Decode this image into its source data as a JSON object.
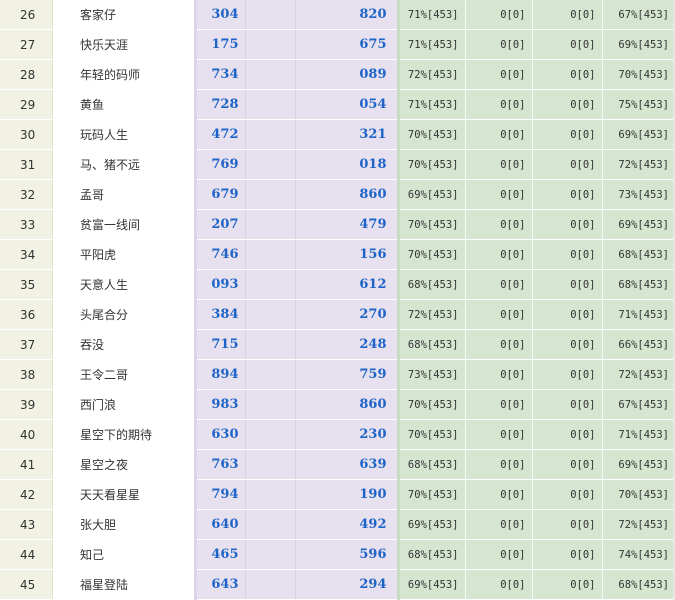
{
  "rows": [
    {
      "rank": "26",
      "name": "客家仔",
      "v1": "304",
      "v2": "820",
      "s1": "71%[453]",
      "s2": "0[0]",
      "s3": "0[0]",
      "s4": "67%[453]"
    },
    {
      "rank": "27",
      "name": "快乐天涯",
      "v1": "175",
      "v2": "675",
      "s1": "71%[453]",
      "s2": "0[0]",
      "s3": "0[0]",
      "s4": "69%[453]"
    },
    {
      "rank": "28",
      "name": "年轻的码师",
      "v1": "734",
      "v2": "089",
      "s1": "72%[453]",
      "s2": "0[0]",
      "s3": "0[0]",
      "s4": "70%[453]"
    },
    {
      "rank": "29",
      "name": "黄鱼",
      "v1": "728",
      "v2": "054",
      "s1": "71%[453]",
      "s2": "0[0]",
      "s3": "0[0]",
      "s4": "75%[453]"
    },
    {
      "rank": "30",
      "name": "玩码人生",
      "v1": "472",
      "v2": "321",
      "s1": "70%[453]",
      "s2": "0[0]",
      "s3": "0[0]",
      "s4": "69%[453]"
    },
    {
      "rank": "31",
      "name": "马、猪不远",
      "v1": "769",
      "v2": "018",
      "s1": "70%[453]",
      "s2": "0[0]",
      "s3": "0[0]",
      "s4": "72%[453]"
    },
    {
      "rank": "32",
      "name": "孟哥",
      "v1": "679",
      "v2": "860",
      "s1": "69%[453]",
      "s2": "0[0]",
      "s3": "0[0]",
      "s4": "73%[453]"
    },
    {
      "rank": "33",
      "name": "贫富一线间",
      "v1": "207",
      "v2": "479",
      "s1": "70%[453]",
      "s2": "0[0]",
      "s3": "0[0]",
      "s4": "69%[453]"
    },
    {
      "rank": "34",
      "name": "平阳虎",
      "v1": "746",
      "v2": "156",
      "s1": "70%[453]",
      "s2": "0[0]",
      "s3": "0[0]",
      "s4": "68%[453]"
    },
    {
      "rank": "35",
      "name": "天意人生",
      "v1": "093",
      "v2": "612",
      "s1": "68%[453]",
      "s2": "0[0]",
      "s3": "0[0]",
      "s4": "68%[453]"
    },
    {
      "rank": "36",
      "name": "头尾合分",
      "v1": "384",
      "v2": "270",
      "s1": "72%[453]",
      "s2": "0[0]",
      "s3": "0[0]",
      "s4": "71%[453]"
    },
    {
      "rank": "37",
      "name": "吞没",
      "v1": "715",
      "v2": "248",
      "s1": "68%[453]",
      "s2": "0[0]",
      "s3": "0[0]",
      "s4": "66%[453]"
    },
    {
      "rank": "38",
      "name": "王令二哥",
      "v1": "894",
      "v2": "759",
      "s1": "73%[453]",
      "s2": "0[0]",
      "s3": "0[0]",
      "s4": "72%[453]"
    },
    {
      "rank": "39",
      "name": "西门浪",
      "v1": "983",
      "v2": "860",
      "s1": "70%[453]",
      "s2": "0[0]",
      "s3": "0[0]",
      "s4": "67%[453]"
    },
    {
      "rank": "40",
      "name": "星空下的期待",
      "v1": "630",
      "v2": "230",
      "s1": "70%[453]",
      "s2": "0[0]",
      "s3": "0[0]",
      "s4": "71%[453]"
    },
    {
      "rank": "41",
      "name": "星空之夜",
      "v1": "763",
      "v2": "639",
      "s1": "68%[453]",
      "s2": "0[0]",
      "s3": "0[0]",
      "s4": "69%[453]"
    },
    {
      "rank": "42",
      "name": "天天看星星",
      "v1": "794",
      "v2": "190",
      "s1": "70%[453]",
      "s2": "0[0]",
      "s3": "0[0]",
      "s4": "70%[453]"
    },
    {
      "rank": "43",
      "name": "张大胆",
      "v1": "640",
      "v2": "492",
      "s1": "69%[453]",
      "s2": "0[0]",
      "s3": "0[0]",
      "s4": "72%[453]"
    },
    {
      "rank": "44",
      "name": "知己",
      "v1": "465",
      "v2": "596",
      "s1": "68%[453]",
      "s2": "0[0]",
      "s3": "0[0]",
      "s4": "74%[453]"
    },
    {
      "rank": "45",
      "name": "福星登陆",
      "v1": "643",
      "v2": "294",
      "s1": "69%[453]",
      "s2": "0[0]",
      "s3": "0[0]",
      "s4": "68%[453]"
    }
  ]
}
